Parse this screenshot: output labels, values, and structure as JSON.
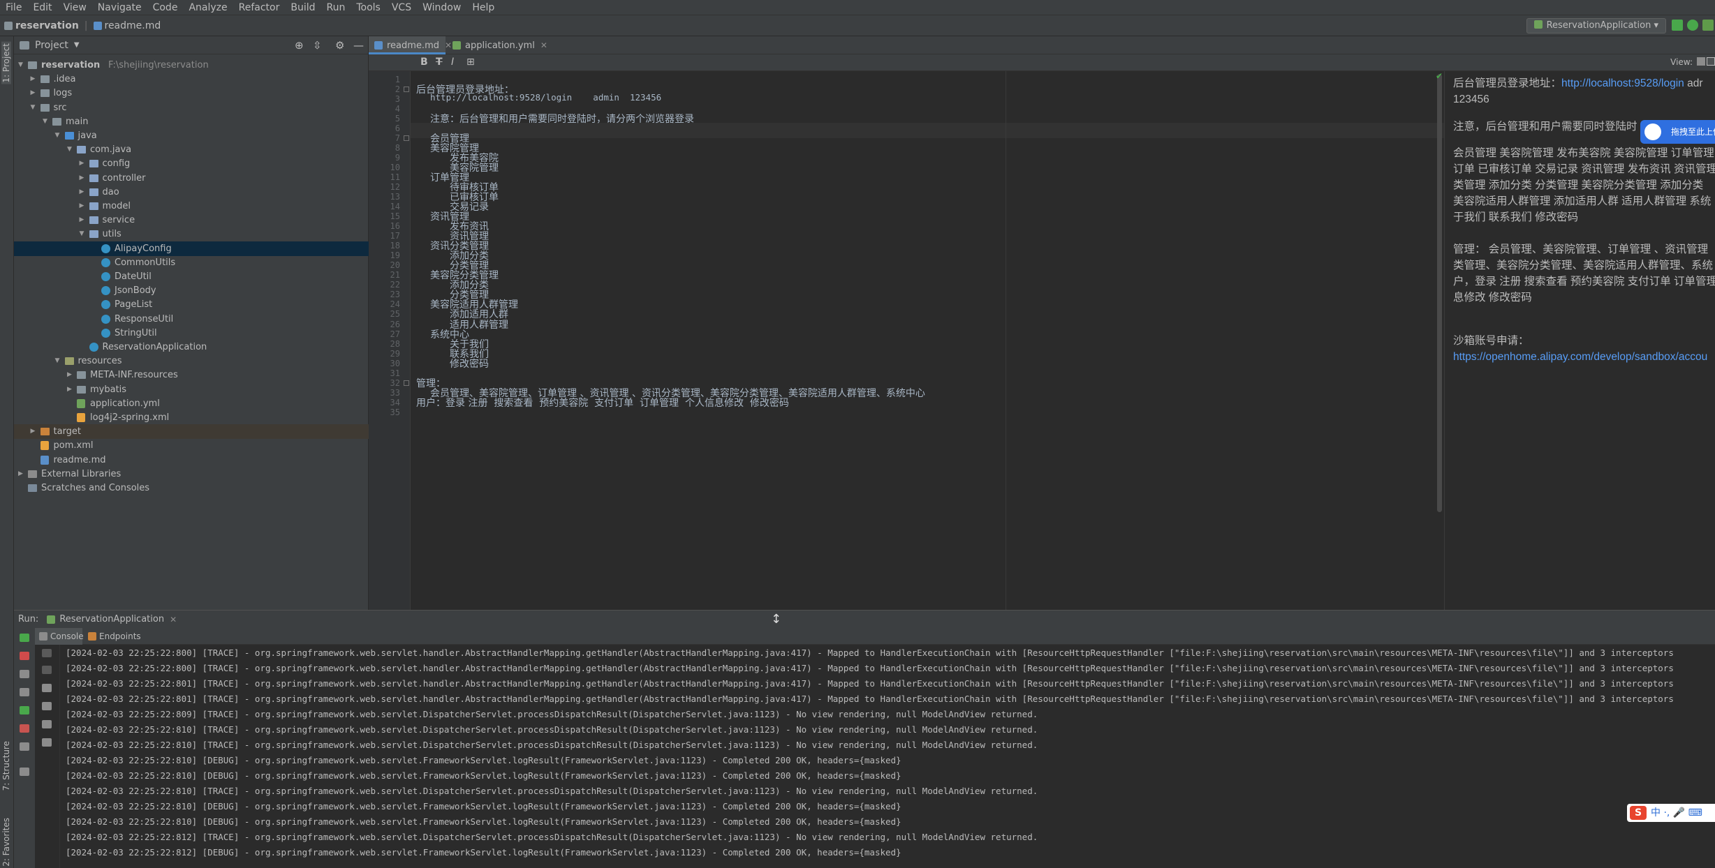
{
  "menu": [
    "File",
    "Edit",
    "View",
    "Navigate",
    "Code",
    "Analyze",
    "Refactor",
    "Build",
    "Run",
    "Tools",
    "VCS",
    "Window",
    "Help"
  ],
  "breadcrumb": [
    "reservation",
    "readme.md"
  ],
  "run_config": "ReservationApplication",
  "left_strip_tabs": [
    "1: Project",
    "7: Structure",
    "2: Favorites"
  ],
  "project": {
    "header": "Project",
    "tree": [
      {
        "label": "reservation",
        "hint": "F:\\shejiing\\reservation",
        "indent": 0,
        "arrow": "open",
        "icon": "folder"
      },
      {
        "label": ".idea",
        "indent": 1,
        "arrow": "closed",
        "icon": "folder"
      },
      {
        "label": "logs",
        "indent": 1,
        "arrow": "closed",
        "icon": "folder"
      },
      {
        "label": "src",
        "indent": 1,
        "arrow": "open",
        "icon": "folder"
      },
      {
        "label": "main",
        "indent": 2,
        "arrow": "open",
        "icon": "folder"
      },
      {
        "label": "java",
        "indent": 3,
        "arrow": "open",
        "icon": "folder-src"
      },
      {
        "label": "com.java",
        "indent": 4,
        "arrow": "open",
        "icon": "package"
      },
      {
        "label": "config",
        "indent": 5,
        "arrow": "closed",
        "icon": "package"
      },
      {
        "label": "controller",
        "indent": 5,
        "arrow": "closed",
        "icon": "package"
      },
      {
        "label": "dao",
        "indent": 5,
        "arrow": "closed",
        "icon": "package"
      },
      {
        "label": "model",
        "indent": 5,
        "arrow": "closed",
        "icon": "package"
      },
      {
        "label": "service",
        "indent": 5,
        "arrow": "closed",
        "icon": "package"
      },
      {
        "label": "utils",
        "indent": 5,
        "arrow": "open",
        "icon": "package"
      },
      {
        "label": "AlipayConfig",
        "indent": 6,
        "icon": "class",
        "selected": true
      },
      {
        "label": "CommonUtils",
        "indent": 6,
        "icon": "class"
      },
      {
        "label": "DateUtil",
        "indent": 6,
        "icon": "class"
      },
      {
        "label": "JsonBody",
        "indent": 6,
        "icon": "class"
      },
      {
        "label": "PageList",
        "indent": 6,
        "icon": "class"
      },
      {
        "label": "ResponseUtil",
        "indent": 6,
        "icon": "class"
      },
      {
        "label": "StringUtil",
        "indent": 6,
        "icon": "class"
      },
      {
        "label": "ReservationApplication",
        "indent": 5,
        "icon": "class"
      },
      {
        "label": "resources",
        "indent": 3,
        "arrow": "open",
        "icon": "folder-res"
      },
      {
        "label": "META-INF.resources",
        "indent": 4,
        "arrow": "closed",
        "icon": "folder"
      },
      {
        "label": "mybatis",
        "indent": 4,
        "arrow": "closed",
        "icon": "folder"
      },
      {
        "label": "application.yml",
        "indent": 4,
        "icon": "yml"
      },
      {
        "label": "log4j2-spring.xml",
        "indent": 4,
        "icon": "xml"
      },
      {
        "label": "target",
        "indent": 1,
        "arrow": "closed",
        "icon": "folder-target",
        "band": true
      },
      {
        "label": "pom.xml",
        "indent": 1,
        "icon": "xml"
      },
      {
        "label": "readme.md",
        "indent": 1,
        "icon": "md"
      },
      {
        "label": "External Libraries",
        "indent": 0,
        "arrow": "closed",
        "icon": "lib"
      },
      {
        "label": "Scratches and Consoles",
        "indent": 0,
        "icon": "scratch"
      }
    ]
  },
  "editor": {
    "tabs": [
      {
        "label": "readme.md",
        "active": true
      },
      {
        "label": "application.yml",
        "active": false
      }
    ],
    "md_toolbar": [
      "B",
      "T",
      "I",
      "⊞"
    ],
    "view_label": "View:",
    "lines": [
      {
        "n": "1",
        "t": "",
        "ind": 0
      },
      {
        "n": "2",
        "t": "后台管理员登录地址：",
        "ind": 0
      },
      {
        "n": "3",
        "t": "http://localhost:9528/login    admin  123456",
        "ind": 1,
        "mono": true
      },
      {
        "n": "4",
        "t": "",
        "ind": 0
      },
      {
        "n": "5",
        "t": "注意：后台管理和用户需要同时登陆时，请分两个浏览器登录",
        "ind": 1
      },
      {
        "n": "6",
        "t": "",
        "ind": 0
      },
      {
        "n": "7",
        "t": "会员管理",
        "ind": 1
      },
      {
        "n": "8",
        "t": "美容院管理",
        "ind": 1
      },
      {
        "n": "9",
        "t": "发布美容院",
        "ind": 2
      },
      {
        "n": "10",
        "t": "美容院管理",
        "ind": 2
      },
      {
        "n": "11",
        "t": "订单管理",
        "ind": 1
      },
      {
        "n": "12",
        "t": "待审核订单",
        "ind": 2
      },
      {
        "n": "13",
        "t": "已审核订单",
        "ind": 2
      },
      {
        "n": "14",
        "t": "交易记录",
        "ind": 2
      },
      {
        "n": "15",
        "t": "资讯管理",
        "ind": 1
      },
      {
        "n": "16",
        "t": "发布资讯",
        "ind": 2
      },
      {
        "n": "17",
        "t": "资讯管理",
        "ind": 2
      },
      {
        "n": "18",
        "t": "资讯分类管理",
        "ind": 1
      },
      {
        "n": "19",
        "t": "添加分类",
        "ind": 2
      },
      {
        "n": "20",
        "t": "分类管理",
        "ind": 2
      },
      {
        "n": "21",
        "t": "美容院分类管理",
        "ind": 1
      },
      {
        "n": "22",
        "t": "添加分类",
        "ind": 2
      },
      {
        "n": "23",
        "t": "分类管理",
        "ind": 2
      },
      {
        "n": "24",
        "t": "美容院适用人群管理",
        "ind": 1
      },
      {
        "n": "25",
        "t": "添加适用人群",
        "ind": 2
      },
      {
        "n": "26",
        "t": "适用人群管理",
        "ind": 2
      },
      {
        "n": "27",
        "t": "系统中心",
        "ind": 1
      },
      {
        "n": "28",
        "t": "关于我们",
        "ind": 2
      },
      {
        "n": "29",
        "t": "联系我们",
        "ind": 2
      },
      {
        "n": "30",
        "t": "修改密码",
        "ind": 2
      },
      {
        "n": "31",
        "t": "",
        "ind": 0
      },
      {
        "n": "32",
        "t": "管理：",
        "ind": 0
      },
      {
        "n": "33",
        "t": "会员管理、美容院管理、订单管理 、资讯管理 、资讯分类管理、美容院分类管理、美容院适用人群管理、系统中心",
        "ind": 1
      },
      {
        "n": "34",
        "t": "用户：登录 注册  搜索查看  预约美容院  支付订单  订单管理  个人信息修改  修改密码",
        "ind": 0
      },
      {
        "n": "35",
        "t": "",
        "ind": 0
      }
    ]
  },
  "preview": {
    "line1_text": "后台管理员登录地址：",
    "line1_link": "http://localhost:9528/login",
    "line1_tail": " adr",
    "line2": "123456",
    "para2": "注意，后台管理和用户需要同时登陆时",
    "para3": [
      "会员管理 美容院管理 发布美容院 美容院管理 订单管理",
      "订单 已审核订单 交易记录 资讯管理 发布资讯 资讯管理",
      "类管理 添加分类 分类管理 美容院分类管理 添加分类",
      "美容院适用人群管理 添加适用人群 适用人群管理 系统",
      "于我们 联系我们 修改密码"
    ],
    "para4": [
      "管理： 会员管理、美容院管理、订单管理 、资讯管理",
      "类管理、美容院分类管理、美容院适用人群管理、系统",
      "户，登录 注册 搜索查看 预约美容院 支付订单 订单管理",
      "息修改 修改密码"
    ],
    "para5": "沙箱账号申请：",
    "para5_link": "https://openhome.alipay.com/develop/sandbox/accou",
    "baidu_button": "拖拽至此上传"
  },
  "run": {
    "label": "Run:",
    "app_tab": "ReservationApplication",
    "tabs": [
      "Console",
      "Endpoints"
    ],
    "logs": [
      "[2024-02-03 22:25:22:800] [TRACE] - org.springframework.web.servlet.handler.AbstractHandlerMapping.getHandler(AbstractHandlerMapping.java:417) - Mapped to HandlerExecutionChain with [ResourceHttpRequestHandler [\"file:F:\\shejiing\\reservation\\src\\main\\resources\\META-INF\\resources\\file\\\"]] and 3 interceptors",
      "[2024-02-03 22:25:22:800] [TRACE] - org.springframework.web.servlet.handler.AbstractHandlerMapping.getHandler(AbstractHandlerMapping.java:417) - Mapped to HandlerExecutionChain with [ResourceHttpRequestHandler [\"file:F:\\shejiing\\reservation\\src\\main\\resources\\META-INF\\resources\\file\\\"]] and 3 interceptors",
      "[2024-02-03 22:25:22:801] [TRACE] - org.springframework.web.servlet.handler.AbstractHandlerMapping.getHandler(AbstractHandlerMapping.java:417) - Mapped to HandlerExecutionChain with [ResourceHttpRequestHandler [\"file:F:\\shejiing\\reservation\\src\\main\\resources\\META-INF\\resources\\file\\\"]] and 3 interceptors",
      "[2024-02-03 22:25:22:801] [TRACE] - org.springframework.web.servlet.handler.AbstractHandlerMapping.getHandler(AbstractHandlerMapping.java:417) - Mapped to HandlerExecutionChain with [ResourceHttpRequestHandler [\"file:F:\\shejiing\\reservation\\src\\main\\resources\\META-INF\\resources\\file\\\"]] and 3 interceptors",
      "[2024-02-03 22:25:22:809] [TRACE] - org.springframework.web.servlet.DispatcherServlet.processDispatchResult(DispatcherServlet.java:1123) - No view rendering, null ModelAndView returned.",
      "[2024-02-03 22:25:22:810] [TRACE] - org.springframework.web.servlet.DispatcherServlet.processDispatchResult(DispatcherServlet.java:1123) - No view rendering, null ModelAndView returned.",
      "[2024-02-03 22:25:22:810] [TRACE] - org.springframework.web.servlet.DispatcherServlet.processDispatchResult(DispatcherServlet.java:1123) - No view rendering, null ModelAndView returned.",
      "[2024-02-03 22:25:22:810] [DEBUG] - org.springframework.web.servlet.FrameworkServlet.logResult(FrameworkServlet.java:1123) - Completed 200 OK, headers={masked}",
      "[2024-02-03 22:25:22:810] [DEBUG] - org.springframework.web.servlet.FrameworkServlet.logResult(FrameworkServlet.java:1123) - Completed 200 OK, headers={masked}",
      "[2024-02-03 22:25:22:810] [TRACE] - org.springframework.web.servlet.DispatcherServlet.processDispatchResult(DispatcherServlet.java:1123) - No view rendering, null ModelAndView returned.",
      "[2024-02-03 22:25:22:810] [DEBUG] - org.springframework.web.servlet.FrameworkServlet.logResult(FrameworkServlet.java:1123) - Completed 200 OK, headers={masked}",
      "[2024-02-03 22:25:22:810] [DEBUG] - org.springframework.web.servlet.FrameworkServlet.logResult(FrameworkServlet.java:1123) - Completed 200 OK, headers={masked}",
      "[2024-02-03 22:25:22:812] [TRACE] - org.springframework.web.servlet.DispatcherServlet.processDispatchResult(DispatcherServlet.java:1123) - No view rendering, null ModelAndView returned.",
      "[2024-02-03 22:25:22:812] [DEBUG] - org.springframework.web.servlet.FrameworkServlet.logResult(FrameworkServlet.java:1123) - Completed 200 OK, headers={masked}"
    ]
  },
  "ime": {
    "logo": "S",
    "text": "中 ·, 🎤 ⌨"
  },
  "colors": {
    "accent": "#4a88c7",
    "selection": "#0d293e",
    "link": "#589df6",
    "folder": "#87939a",
    "package": "#8aa4c8",
    "source_folder": "#4a8fd6",
    "resources_folder": "#9aa06b",
    "target_folder": "#c9823b"
  }
}
